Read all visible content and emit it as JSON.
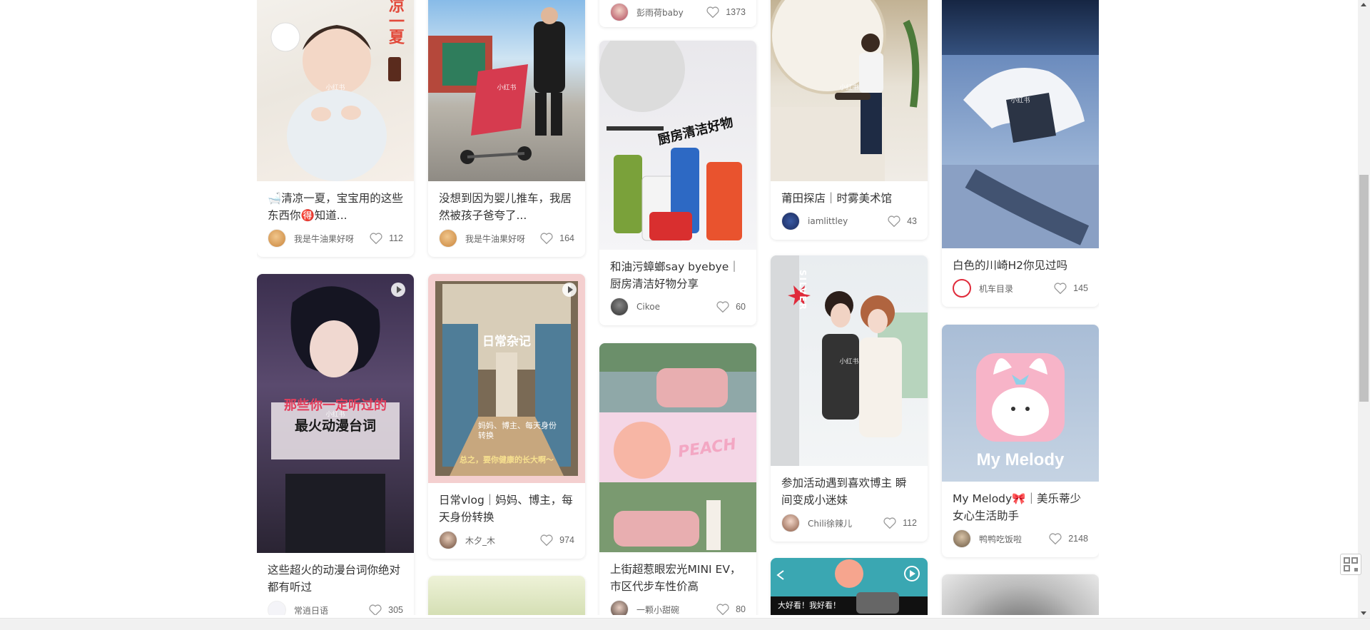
{
  "columns": [
    {
      "cards": [
        {
          "title": "🛁清凉一夏，宝宝用的这些东西你🉐知道...",
          "author": "我是牛油果好呀",
          "likes": "112",
          "cover_text": "凉一夏",
          "watermark": "小红书"
        },
        {
          "title": "这些超火的动漫台词你绝对都有听过",
          "author": "常逍日语",
          "likes": "305",
          "cover_text_line1": "那些你一定听过的",
          "cover_text_line2": "最火动漫台词",
          "watermark": "小红书"
        }
      ]
    },
    {
      "cards": [
        {
          "title": "没想到因为婴儿推车，我居然被孩子爸夸了...",
          "author": "我是牛油果好呀",
          "likes": "164",
          "watermark": "小红书"
        },
        {
          "title": "日常vlog｜妈妈、博主，每天身份转换",
          "author": "木夕_木",
          "likes": "974",
          "cover_text_line1": "日常杂记",
          "cover_text_line2": "妈妈、博主、每天身份转换",
          "cover_text_line3": "总之，要你健康的长大啊～"
        },
        {
          "title": "",
          "author": "",
          "likes": ""
        }
      ]
    },
    {
      "cards": [
        {
          "author": "彭雨荷baby",
          "likes": "1373"
        },
        {
          "title": "和油污蟑螂say byebye｜厨房清洁好物分享",
          "author": "Cikoe",
          "likes": "60",
          "cover_text": "厨房清洁好物"
        },
        {
          "title": "上街超惹眼宏光MINI EV，市区代步车性价高",
          "author": "一颗小甜碗",
          "likes": "80",
          "cover_text": "PEACH"
        }
      ]
    },
    {
      "cards": [
        {
          "title": "莆田探店｜时雾美术馆",
          "author": "iamlittley",
          "likes": "43",
          "watermark": "小红书"
        },
        {
          "title": "参加活动遇到喜欢博主 瞬间变成小迷妹",
          "author": "Chili徐辣儿",
          "likes": "112",
          "cover_text": "SILVER",
          "watermark": "小红书"
        },
        {
          "cover_text": "大好看！我好看！"
        }
      ]
    },
    {
      "cards": [
        {
          "title": "白色的川崎H2你见过吗",
          "author": "机车目录",
          "likes": "145",
          "watermark": "小红书"
        },
        {
          "title": "My Melody🎀｜美乐蒂少女心生活助手",
          "author": "鸭鸭吃饭啦",
          "likes": "2148",
          "cover_text": "My Melody"
        },
        {
          "title": ""
        }
      ]
    }
  ],
  "colors": {
    "accent": "#ff2442",
    "like_icon": "#999999"
  }
}
